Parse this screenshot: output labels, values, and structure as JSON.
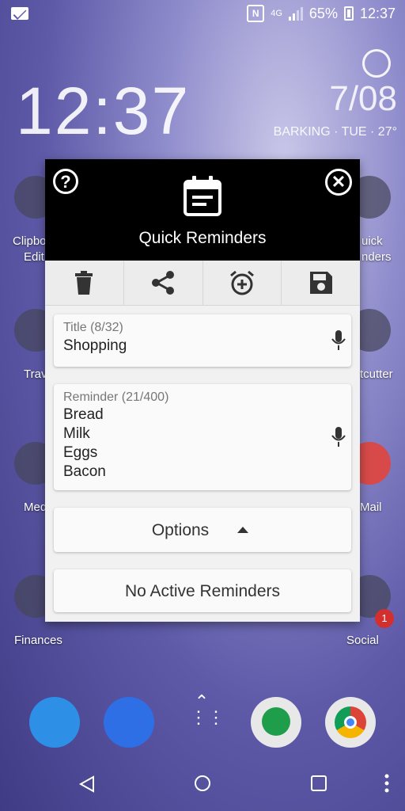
{
  "status_bar": {
    "network": "4G",
    "battery": "65%",
    "time": "12:37"
  },
  "clock_widget": {
    "time": "12:37",
    "date": "7/08",
    "location_weather": "BARKING · TUE · 27°"
  },
  "home_labels": {
    "clipboard": "Clipbo",
    "clipboard2": "Edit",
    "travel": "Trav",
    "media": "Med",
    "finances": "Finances",
    "quick": "uick",
    "quick2": "nders",
    "cutter": "tcutter",
    "mail": "Mail",
    "social": "Social",
    "social_badge": "1"
  },
  "dialog": {
    "title": "Quick Reminders",
    "help_icon": "?",
    "close_icon": "✕",
    "toolbar": [
      "delete-icon",
      "share-icon",
      "add-alarm-icon",
      "save-icon"
    ],
    "title_field": {
      "label": "Title (8/32)",
      "value": "Shopping"
    },
    "reminder_field": {
      "label": "Reminder (21/400)",
      "value": "Bread\nMilk\nEggs\nBacon"
    },
    "options_label": "Options",
    "status_label": "No Active Reminders"
  },
  "colors": {
    "header_bg": "#000000",
    "dialog_bg": "#f1f1f1",
    "card_bg": "#fafafa",
    "text": "#222222"
  }
}
